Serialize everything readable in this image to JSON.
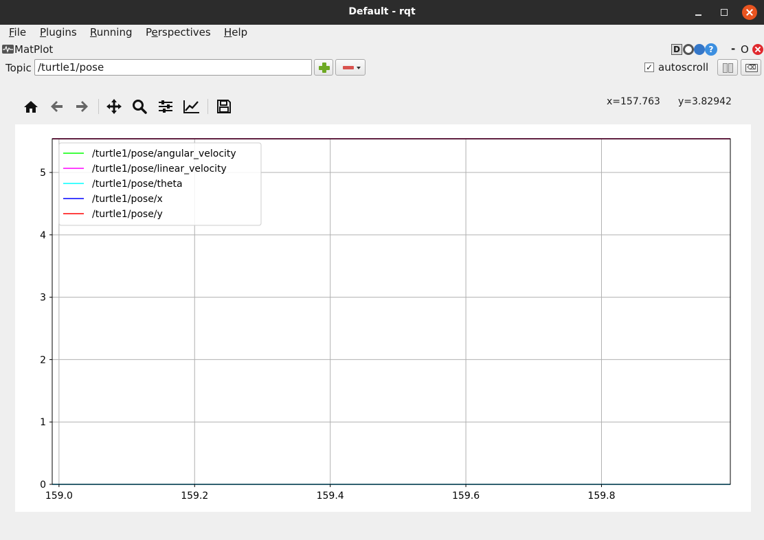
{
  "window": {
    "title": "Default - rqt"
  },
  "menubar": {
    "items": [
      {
        "mnemonic": "F",
        "rest": "ile"
      },
      {
        "mnemonic": "P",
        "rest": "lugins"
      },
      {
        "mnemonic": "R",
        "rest": "unning"
      },
      {
        "pre": "P",
        "mnemonic": "e",
        "rest": "rspectives"
      },
      {
        "mnemonic": "H",
        "rest": "elp"
      }
    ]
  },
  "plugin": {
    "title": "MatPlot",
    "help_d": "D",
    "help_q": "?",
    "minimize_label": "-",
    "float_label": "O"
  },
  "topic": {
    "label": "Topic",
    "value": "/turtle1/pose"
  },
  "autoscroll": {
    "checked": "✓",
    "label": "autoscroll"
  },
  "icons": {
    "toolbar": [
      "home-icon",
      "back-icon",
      "forward-icon",
      "pan-icon",
      "zoom-icon",
      "configure-subplots-icon",
      "edit-axis-icon",
      "save-icon"
    ],
    "clear_tag": "⌫"
  },
  "cursor": {
    "x_text": "x=157.763",
    "y_text": "y=3.82942"
  },
  "chart_data": {
    "type": "line",
    "title": "",
    "xlabel": "",
    "ylabel": "",
    "xlim": [
      158.99,
      159.99
    ],
    "ylim": [
      0,
      5.54
    ],
    "xticks": [
      159.0,
      159.2,
      159.4,
      159.6,
      159.8
    ],
    "xtick_labels": [
      "159.0",
      "159.2",
      "159.4",
      "159.6",
      "159.8"
    ],
    "yticks": [
      0,
      1,
      2,
      3,
      4,
      5
    ],
    "ytick_labels": [
      "0",
      "1",
      "2",
      "3",
      "4",
      "5"
    ],
    "grid": true,
    "legend_position": "top-left",
    "series": [
      {
        "name": "/turtle1/pose/angular_velocity",
        "color": "#00ff00",
        "x": [
          158.99,
          159.99
        ],
        "y": [
          0,
          0
        ]
      },
      {
        "name": "/turtle1/pose/linear_velocity",
        "color": "#ff00ff",
        "x": [
          158.99,
          159.99
        ],
        "y": [
          0,
          0
        ]
      },
      {
        "name": "/turtle1/pose/theta",
        "color": "#00ffff",
        "x": [
          158.99,
          159.99
        ],
        "y": [
          0,
          0
        ]
      },
      {
        "name": "/turtle1/pose/x",
        "color": "#0000ff",
        "x": [
          158.99,
          159.99
        ],
        "y": [
          5.54,
          5.54
        ]
      },
      {
        "name": "/turtle1/pose/y",
        "color": "#ff0000",
        "x": [
          158.99,
          159.99
        ],
        "y": [
          5.54,
          5.54
        ]
      }
    ]
  }
}
